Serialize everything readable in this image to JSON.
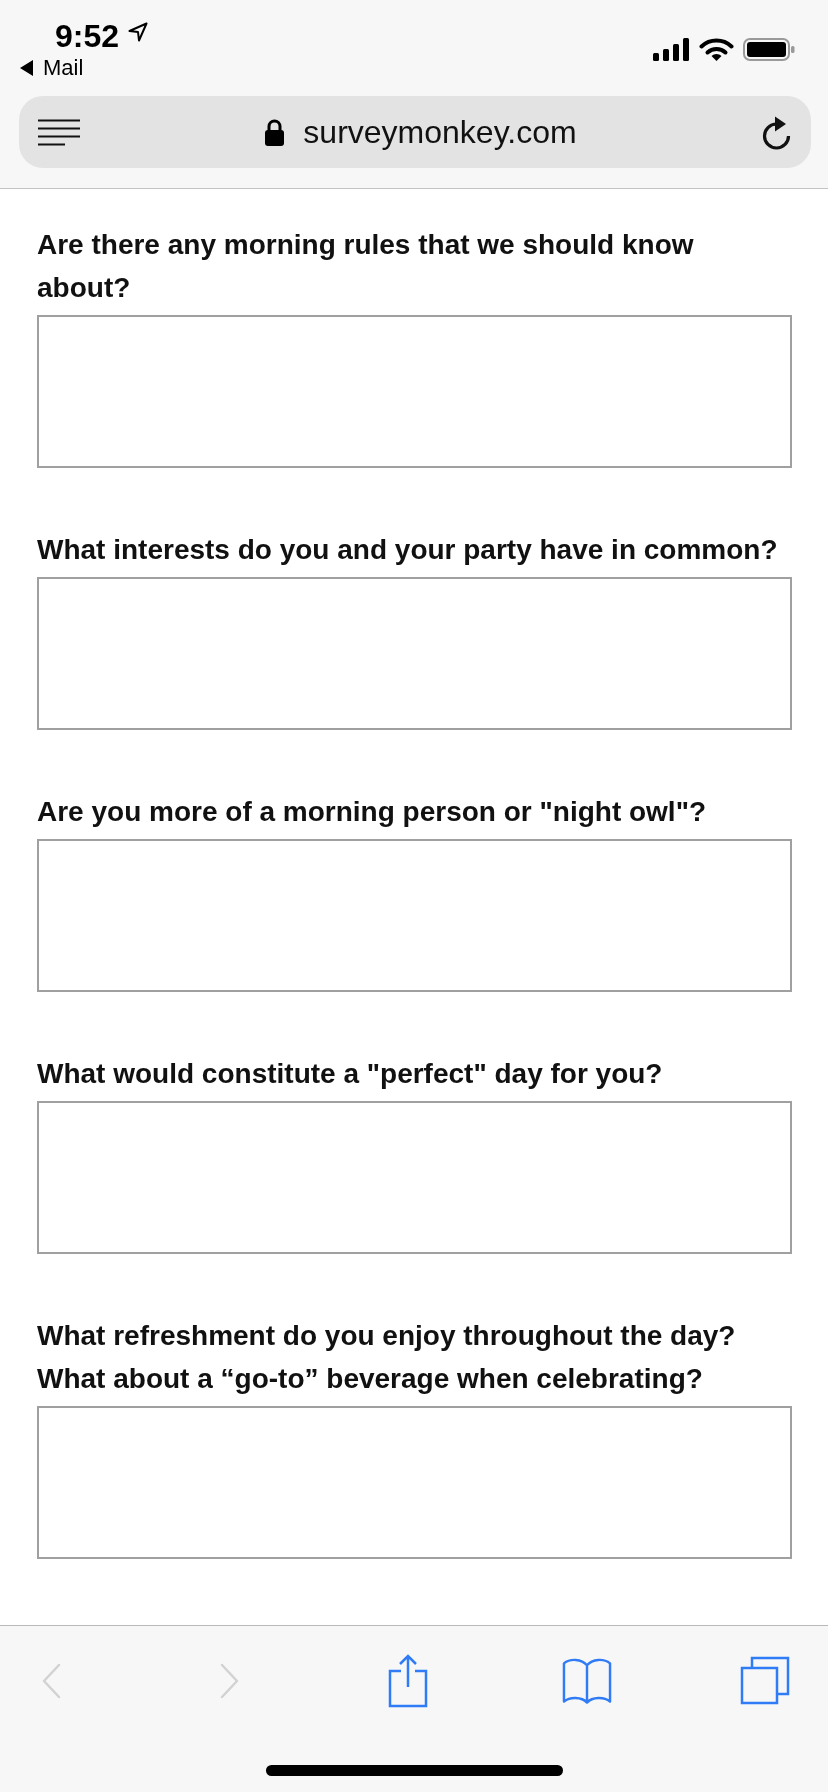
{
  "status_bar": {
    "time": "9:52",
    "back_app": "Mail"
  },
  "address_bar": {
    "url": "surveymonkey.com"
  },
  "questions": [
    {
      "text": "Are there any morning rules that we should know\nabout?"
    },
    {
      "text": "What interests do you and your party have in common?"
    },
    {
      "text": "Are you more of a morning person or \"night owl\"?"
    },
    {
      "text": "What would constitute a \"perfect\" day for you?"
    },
    {
      "text": "What refreshment do you enjoy throughout the day?\nWhat about a “go-to” beverage when celebrating?"
    }
  ],
  "toolbar": [
    {
      "kind": "back",
      "disabled": true
    },
    {
      "kind": "forward",
      "disabled": true
    },
    {
      "kind": "share",
      "disabled": false
    },
    {
      "kind": "bookmarks",
      "disabled": false
    },
    {
      "kind": "tabs",
      "disabled": false
    }
  ]
}
